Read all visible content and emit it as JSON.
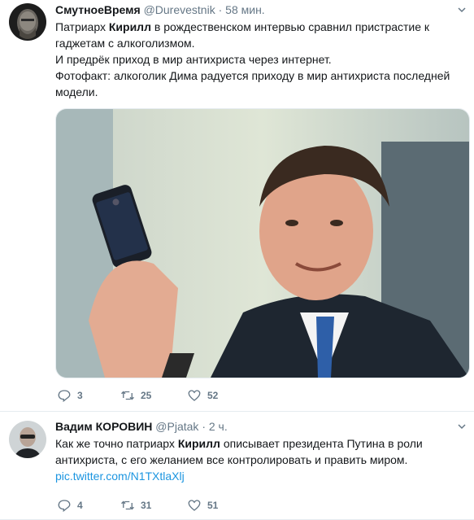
{
  "tweets": [
    {
      "name": "СмутноеВремя",
      "handle": "@Durevestnik",
      "time": "58 мин.",
      "line1_pre": "Патриарх ",
      "line1_bold": "Кирилл",
      "line1_post": " в рождественском интервью сравнил пристрастие к гаджетам с алкоголизмом.",
      "line2": "И предрёк приход в мир антихриста через интернет.",
      "line3": "Фотофакт: алкоголик Дима радуется приходу в мир антихриста последней модели.",
      "replies": "3",
      "retweets": "25",
      "likes": "52"
    },
    {
      "name": "Вадим КОРОВИН",
      "handle": "@Pjatak",
      "time": "2 ч.",
      "line1_pre": "Как же точно патриарх ",
      "line1_bold": "Кирилл",
      "line1_post": " описывает президента Путина в роли антихриста, с его желанием все контролировать и править миром.",
      "link": "pic.twitter.com/N1TXtlaXlj",
      "replies": "4",
      "retweets": "31",
      "likes": "51"
    }
  ],
  "separator": "·",
  "colors": {
    "link": "#1b95e0",
    "muted": "#657786",
    "border": "#e6ecf0"
  },
  "icons": [
    "reply-icon",
    "retweet-icon",
    "like-icon",
    "chevron-down-icon"
  ]
}
